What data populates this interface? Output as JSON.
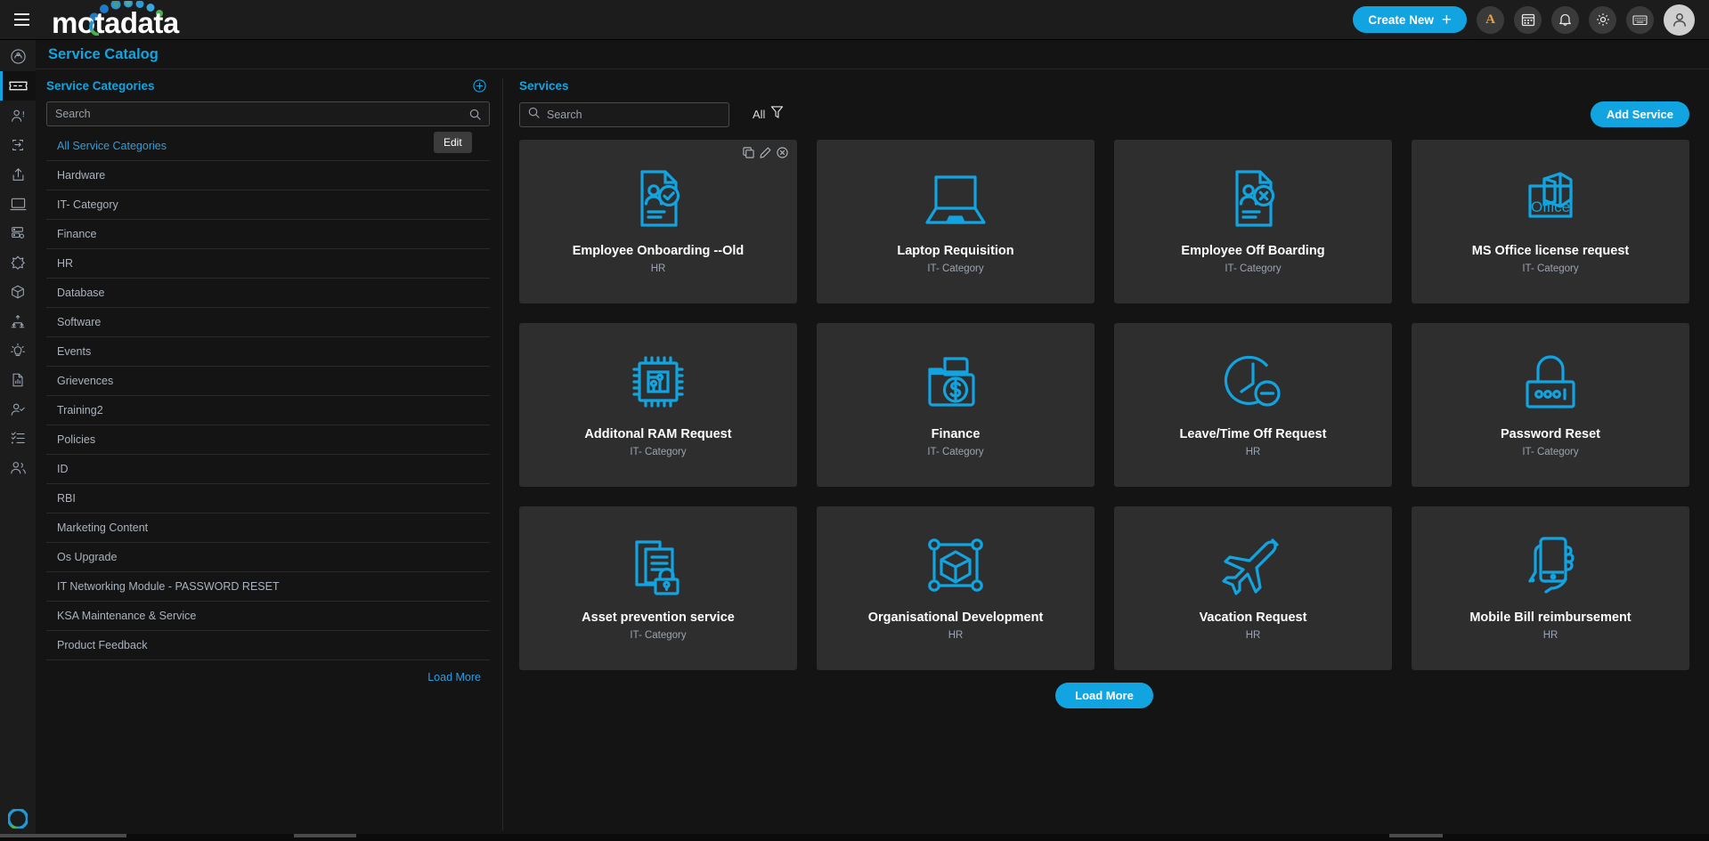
{
  "header": {
    "menu_icon": "hamburger-icon",
    "logo_text": "motadata",
    "create_new_label": "Create New",
    "create_new_plus": "+",
    "icons": [
      {
        "name": "announcement-a-icon",
        "glyph": "A"
      },
      {
        "name": "calendar-icon",
        "glyph": ""
      },
      {
        "name": "notification-bell-icon",
        "glyph": ""
      },
      {
        "name": "settings-gear-icon",
        "glyph": ""
      },
      {
        "name": "keyboard-shortcut-icon",
        "glyph": ""
      },
      {
        "name": "user-avatar-icon",
        "glyph": ""
      }
    ]
  },
  "rail": {
    "items": [
      {
        "name": "dashboard-icon",
        "active": false
      },
      {
        "name": "ticket-icon",
        "active": true
      },
      {
        "name": "user-request-icon",
        "active": false
      },
      {
        "name": "change-icon",
        "active": false
      },
      {
        "name": "release-icon",
        "active": false
      },
      {
        "name": "asset-monitor-icon",
        "active": false
      },
      {
        "name": "server-config-icon",
        "active": false
      },
      {
        "name": "integration-icon",
        "active": false
      },
      {
        "name": "package-icon",
        "active": false
      },
      {
        "name": "workflow-icon",
        "active": false
      },
      {
        "name": "knowledge-bulb-icon",
        "active": false
      },
      {
        "name": "report-icon",
        "active": false
      },
      {
        "name": "user-add-icon",
        "active": false
      },
      {
        "name": "task-list-icon",
        "active": false
      },
      {
        "name": "team-icon",
        "active": false
      }
    ]
  },
  "page": {
    "title": "Service Catalog"
  },
  "categories": {
    "title": "Service Categories",
    "add_icon": "add-circle-icon",
    "search_placeholder": "Search",
    "search_value": "",
    "edit_tooltip": "Edit",
    "load_more_label": "Load More",
    "items": [
      {
        "label": "All Service Categories",
        "selected": true
      },
      {
        "label": "Hardware",
        "selected": false
      },
      {
        "label": "IT- Category",
        "selected": false
      },
      {
        "label": "Finance",
        "selected": false
      },
      {
        "label": "HR",
        "selected": false
      },
      {
        "label": "Database",
        "selected": false
      },
      {
        "label": "Software",
        "selected": false
      },
      {
        "label": "Events",
        "selected": false
      },
      {
        "label": "Grievences",
        "selected": false
      },
      {
        "label": "Training2",
        "selected": false
      },
      {
        "label": "Policies",
        "selected": false
      },
      {
        "label": "ID",
        "selected": false
      },
      {
        "label": "RBI",
        "selected": false
      },
      {
        "label": "Marketing Content",
        "selected": false
      },
      {
        "label": "Os Upgrade",
        "selected": false
      },
      {
        "label": "IT Networking Module - PASSWORD RESET",
        "selected": false
      },
      {
        "label": "KSA Maintenance & Service",
        "selected": false
      },
      {
        "label": "Product Feedback",
        "selected": false
      }
    ]
  },
  "services": {
    "title": "Services",
    "search_placeholder": "Search",
    "search_value": "",
    "filter_label": "All",
    "filter_icon": "funnel-filter-icon",
    "add_service_label": "Add Service",
    "load_more_label": "Load More",
    "card_actions": [
      {
        "name": "duplicate-icon"
      },
      {
        "name": "edit-pencil-icon"
      },
      {
        "name": "delete-circle-icon"
      }
    ],
    "cards": [
      {
        "name": "Employee Onboarding --Old",
        "category": "HR",
        "icon": "document-person-check-icon",
        "show_actions": true
      },
      {
        "name": "Laptop Requisition",
        "category": "IT- Category",
        "icon": "laptop-icon",
        "show_actions": false
      },
      {
        "name": "Employee Off Boarding",
        "category": "IT- Category",
        "icon": "document-person-x-icon",
        "show_actions": false
      },
      {
        "name": "MS Office license request",
        "category": "IT- Category",
        "icon": "ms-office-icon",
        "show_actions": false
      },
      {
        "name": "Additonal RAM Request",
        "category": "IT- Category",
        "icon": "cpu-chip-icon",
        "show_actions": false
      },
      {
        "name": "Finance",
        "category": "IT- Category",
        "icon": "folder-dollar-icon",
        "show_actions": false
      },
      {
        "name": "Leave/Time Off Request",
        "category": "HR",
        "icon": "clock-minus-icon",
        "show_actions": false
      },
      {
        "name": "Password Reset",
        "category": "IT- Category",
        "icon": "padlock-keypad-icon",
        "show_actions": false
      },
      {
        "name": "Asset prevention service",
        "category": "IT- Category",
        "icon": "documents-lock-icon",
        "show_actions": false
      },
      {
        "name": "Organisational Development",
        "category": "HR",
        "icon": "cube-network-icon",
        "show_actions": false
      },
      {
        "name": "Vacation Request",
        "category": "HR",
        "icon": "airplane-icon",
        "show_actions": false
      },
      {
        "name": "Mobile Bill reimbursement",
        "category": "HR",
        "icon": "hand-mobile-icon",
        "show_actions": false
      }
    ]
  },
  "colors": {
    "accent": "#12A4E0",
    "card_bg": "#2e2e2e",
    "page_bg": "#141414",
    "panel_bg": "#1c1c1c"
  }
}
